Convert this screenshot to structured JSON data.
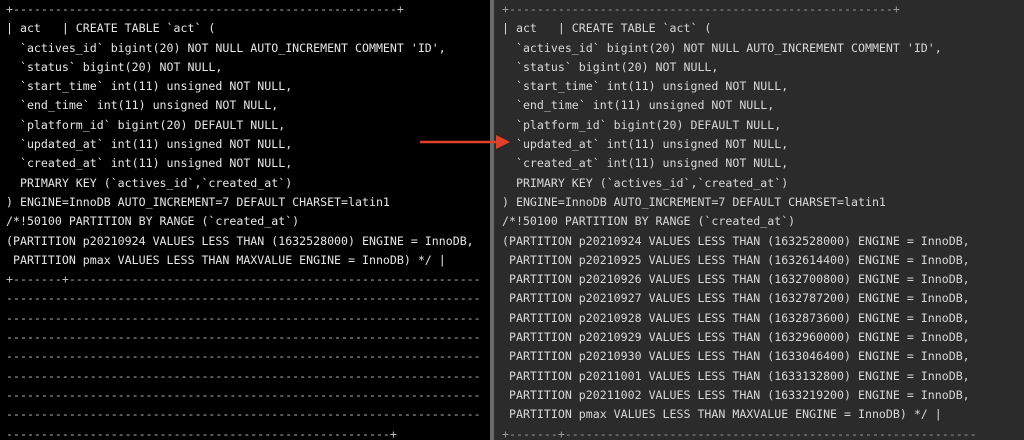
{
  "left_terminal": {
    "lines": [
      "+-------------------------------------------------------+",
      "| act   | CREATE TABLE `act` (",
      "  `actives_id` bigint(20) NOT NULL AUTO_INCREMENT COMMENT 'ID',",
      "  `status` bigint(20) NOT NULL,",
      "  `start_time` int(11) unsigned NOT NULL,",
      "  `end_time` int(11) unsigned NOT NULL,",
      "  `platform_id` bigint(20) DEFAULT NULL,",
      "  `updated_at` int(11) unsigned NOT NULL,",
      "  `created_at` int(11) unsigned NOT NULL,",
      "  PRIMARY KEY (`actives_id`,`created_at`)",
      ") ENGINE=InnoDB AUTO_INCREMENT=7 DEFAULT CHARSET=latin1",
      "/*!50100 PARTITION BY RANGE (`created_at`)",
      "(PARTITION p20210924 VALUES LESS THAN (1632528000) ENGINE = InnoDB,",
      " PARTITION pmax VALUES LESS THAN MAXVALUE ENGINE = InnoDB) */ |",
      "+-------+-----------------------------------------------------------",
      "--------------------------------------------------------------------",
      "--------------------------------------------------------------------",
      "--------------------------------------------------------------------",
      "--------------------------------------------------------------------",
      "--------------------------------------------------------------------",
      "--------------------------------------------------------------------",
      "--------------------------------------------------------------------",
      "-------------------------------------------------------+"
    ]
  },
  "right_terminal": {
    "lines": [
      "+-------------------------------------------------------+",
      "| act   | CREATE TABLE `act` (",
      "  `actives_id` bigint(20) NOT NULL AUTO_INCREMENT COMMENT 'ID',",
      "  `status` bigint(20) NOT NULL,",
      "  `start_time` int(11) unsigned NOT NULL,",
      "  `end_time` int(11) unsigned NOT NULL,",
      "  `platform_id` bigint(20) DEFAULT NULL,",
      "  `updated_at` int(11) unsigned NOT NULL,",
      "  `created_at` int(11) unsigned NOT NULL,",
      "  PRIMARY KEY (`actives_id`,`created_at`)",
      ") ENGINE=InnoDB AUTO_INCREMENT=7 DEFAULT CHARSET=latin1",
      "/*!50100 PARTITION BY RANGE (`created_at`)",
      "(PARTITION p20210924 VALUES LESS THAN (1632528000) ENGINE = InnoDB,",
      " PARTITION p20210925 VALUES LESS THAN (1632614400) ENGINE = InnoDB,",
      " PARTITION p20210926 VALUES LESS THAN (1632700800) ENGINE = InnoDB,",
      " PARTITION p20210927 VALUES LESS THAN (1632787200) ENGINE = InnoDB,",
      " PARTITION p20210928 VALUES LESS THAN (1632873600) ENGINE = InnoDB,",
      " PARTITION p20210929 VALUES LESS THAN (1632960000) ENGINE = InnoDB,",
      " PARTITION p20210930 VALUES LESS THAN (1633046400) ENGINE = InnoDB,",
      " PARTITION p20211001 VALUES LESS THAN (1633132800) ENGINE = InnoDB,",
      " PARTITION p20211002 VALUES LESS THAN (1633219200) ENGINE = InnoDB,",
      " PARTITION pmax VALUES LESS THAN MAXVALUE ENGINE = InnoDB) */ |",
      "+-------+-----------------------------------------------------------"
    ]
  },
  "arrow_color": "#e0412b",
  "colors": {
    "left_background": "#000000",
    "right_background": "#2b2b2b",
    "left_text": "#e6e6e6",
    "right_text": "#d8d8d8"
  }
}
